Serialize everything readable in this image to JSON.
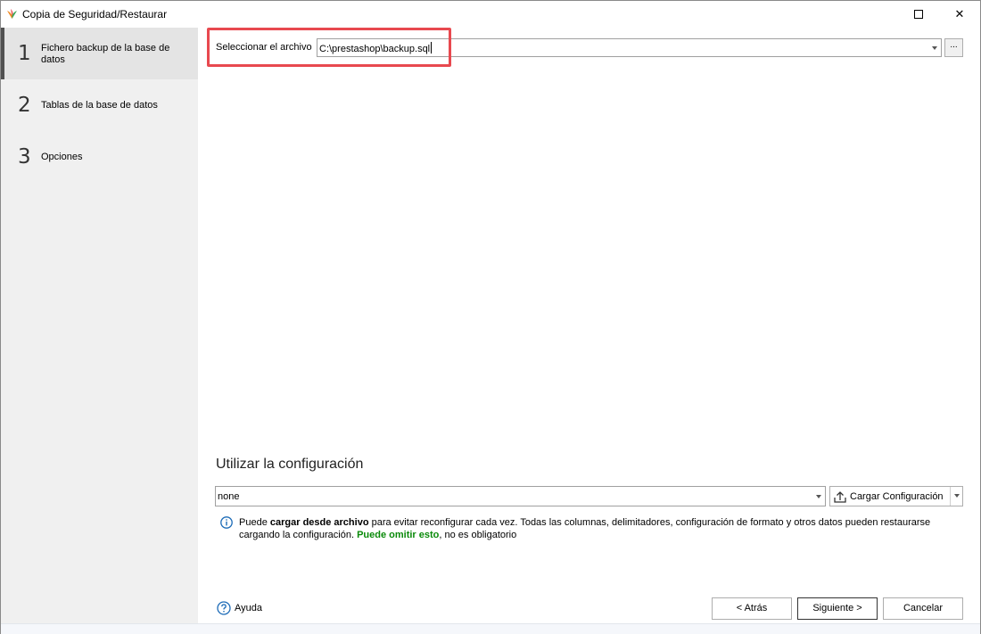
{
  "window": {
    "title": "Copia de Seguridad/Restaurar",
    "controls": [
      "maximize-icon",
      "close-icon"
    ],
    "close_glyph": "✕"
  },
  "steps": [
    {
      "number": "1",
      "label": "Fichero backup de la base de datos",
      "active": true
    },
    {
      "number": "2",
      "label": "Tablas de la base de datos",
      "active": false
    },
    {
      "number": "3",
      "label": "Opciones",
      "active": false
    }
  ],
  "file": {
    "label": "Seleccionar el archivo",
    "value": "C:\\prestashop\\backup.sql",
    "browse_label": "..."
  },
  "config": {
    "title": "Utilizar la configuración",
    "value": "none",
    "load_label": "Cargar Configuración"
  },
  "info": {
    "t1": "Puede ",
    "b1": "cargar desde archivo",
    "t2": " para evitar reconfigurar cada vez. Todas las columnas, delimitadores, configuración de formato y otros datos pueden restaurarse cargando la configuración. ",
    "g1": "Puede omitir esto",
    "t3": ", no es obligatorio"
  },
  "footer": {
    "help_label": "Ayuda",
    "back_label": "< Atrás",
    "next_label": "Siguiente >",
    "cancel_label": "Cancelar"
  },
  "colors": {
    "highlight": "#e8494f",
    "sidebar_bg": "#f0f0f0",
    "active_step_bg": "#e4e4e4",
    "info_green": "#0a8a0a",
    "icon_blue": "#1c6bb7"
  }
}
